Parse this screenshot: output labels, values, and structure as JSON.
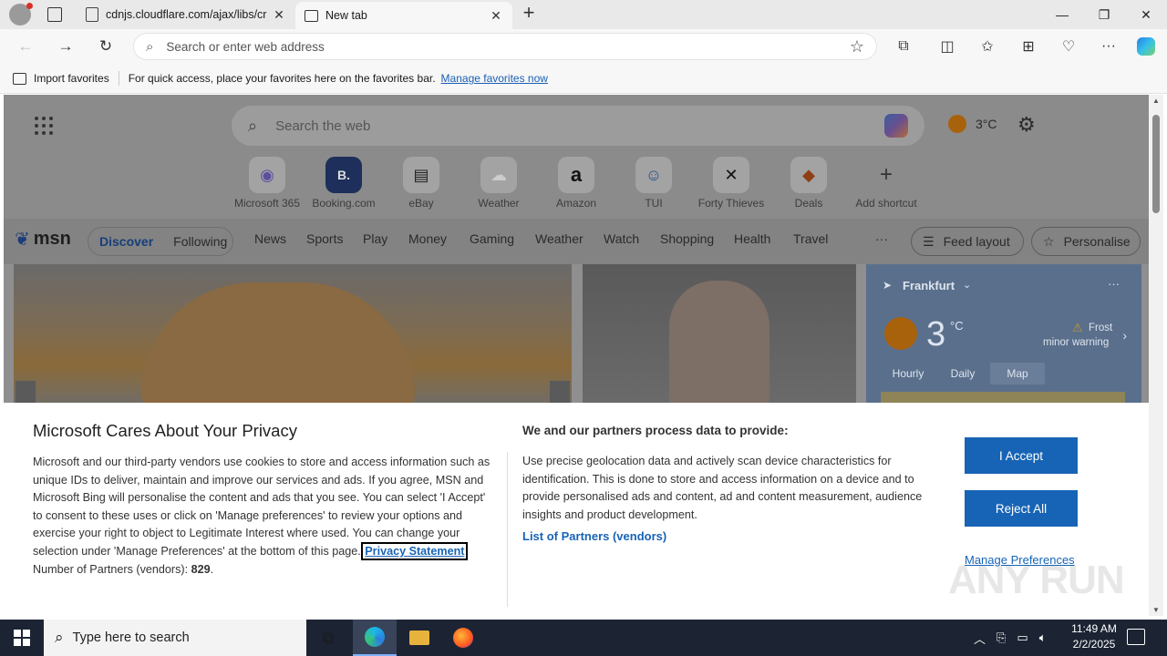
{
  "browser": {
    "tabs": [
      {
        "label": "cdnjs.cloudflare.com/ajax/libs/cr",
        "icon": "page-icon",
        "active": false
      },
      {
        "label": "New tab",
        "icon": "newtab-icon",
        "active": true
      }
    ],
    "address_placeholder": "Search or enter web address",
    "favorites_bar": {
      "import_label": "Import favorites",
      "hint_text": "For quick access, place your favorites here on the favorites bar.",
      "manage_link": "Manage favorites now"
    }
  },
  "msn": {
    "search_placeholder": "Search the web",
    "temperature": "3°C",
    "shortcuts": [
      {
        "label": "Microsoft 365",
        "glyph": "◉"
      },
      {
        "label": "Booking.com",
        "glyph": "B."
      },
      {
        "label": "eBay",
        "glyph": "▤"
      },
      {
        "label": "Weather",
        "glyph": "☁"
      },
      {
        "label": "Amazon",
        "glyph": "a"
      },
      {
        "label": "TUI",
        "glyph": "☺"
      },
      {
        "label": "Forty Thieves",
        "glyph": "✕"
      },
      {
        "label": "Deals",
        "glyph": "◆"
      },
      {
        "label": "Add shortcut",
        "glyph": "+"
      }
    ],
    "logo": "msn",
    "feed_tabs": [
      "Discover",
      "Following"
    ],
    "nav": [
      "News",
      "Sports",
      "Play",
      "Money",
      "Gaming",
      "Weather",
      "Watch",
      "Shopping",
      "Health",
      "Travel"
    ],
    "more": "···",
    "feed_layout": "Feed layout",
    "personalise": "Personalise",
    "weather": {
      "city": "Frankfurt",
      "temp": "3",
      "unit": "°C",
      "alert_title": "Frost",
      "alert_sub": "minor warning",
      "tabs": [
        "Hourly",
        "Daily",
        "Map"
      ]
    }
  },
  "consent": {
    "title": "Microsoft Cares About Your Privacy",
    "left_text": "Microsoft and our third-party vendors use cookies to store and access information such as unique IDs to deliver, maintain and improve our services and ads. If you agree, MSN and Microsoft Bing will personalise the content and ads that you see. You can select 'I Accept' to consent to these uses or click on 'Manage preferences' to review your options and exercise your right to object to Legitimate Interest where used.  You can change your selection under 'Manage Preferences' at the bottom of this page.",
    "privacy_link": "Privacy Statement",
    "partners_count_label": "Number of Partners (vendors):",
    "partners_count": "829",
    "right_heading": "We and our partners process data to provide:",
    "right_text": "Use precise geolocation data and actively scan device characteristics for identification. This is done to store and access information on a device and to provide personalised ads and content, ad and content measurement, audience insights and product development.",
    "partners_link": "List of Partners (vendors)",
    "accept": "I Accept",
    "reject": "Reject All",
    "manage": "Manage Preferences"
  },
  "watermark": "ANY RUN",
  "taskbar": {
    "search_placeholder": "Type here to search",
    "time": "11:49 AM",
    "date": "2/2/2025"
  },
  "colors": {
    "accent": "#1764b6",
    "taskbar": "#1c2433"
  }
}
